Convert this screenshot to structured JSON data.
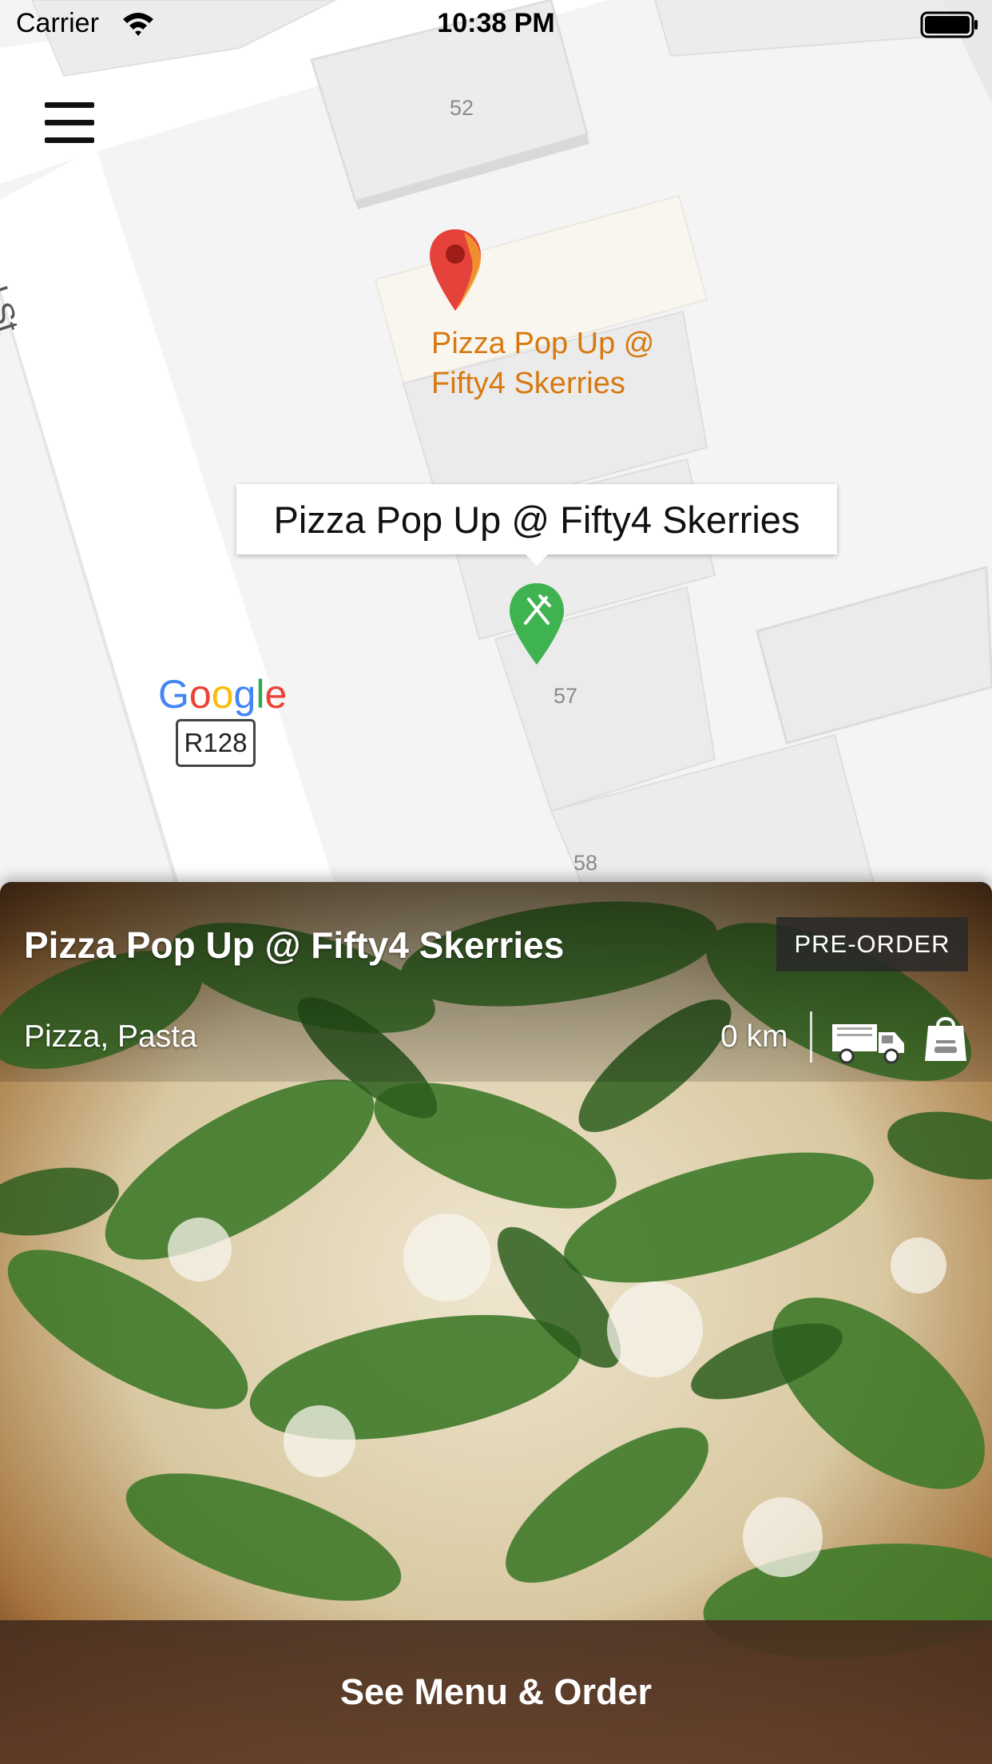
{
  "status_bar": {
    "carrier": "Carrier",
    "time": "10:38 PM",
    "wifi_icon": "wifi-icon",
    "battery_icon": "battery-icon"
  },
  "map": {
    "menu_icon": "hamburger-menu-icon",
    "street_name": "Strand St",
    "building_numbers": [
      "52",
      "57",
      "58"
    ],
    "poi_name": "Pizza Pop Up @ Fifty4 Skerries",
    "callout_text": "Pizza Pop Up @ Fifty4 Skerries",
    "provider": "Google",
    "route_badge": "R128",
    "marker_icon": "fork-knife-icon",
    "colors": {
      "poi_pin": "#e5423b",
      "poi_label": "#d7790f",
      "restaurant_marker": "#3fb34f"
    }
  },
  "restaurant_card": {
    "title": "Pizza Pop Up @ Fifty4 Skerries",
    "badge": "PRE-ORDER",
    "cuisine": "Pizza, Pasta",
    "distance": "0 km",
    "service_icons": [
      "delivery-truck-icon",
      "shopping-bag-icon"
    ],
    "action_label": "See Menu & Order"
  }
}
